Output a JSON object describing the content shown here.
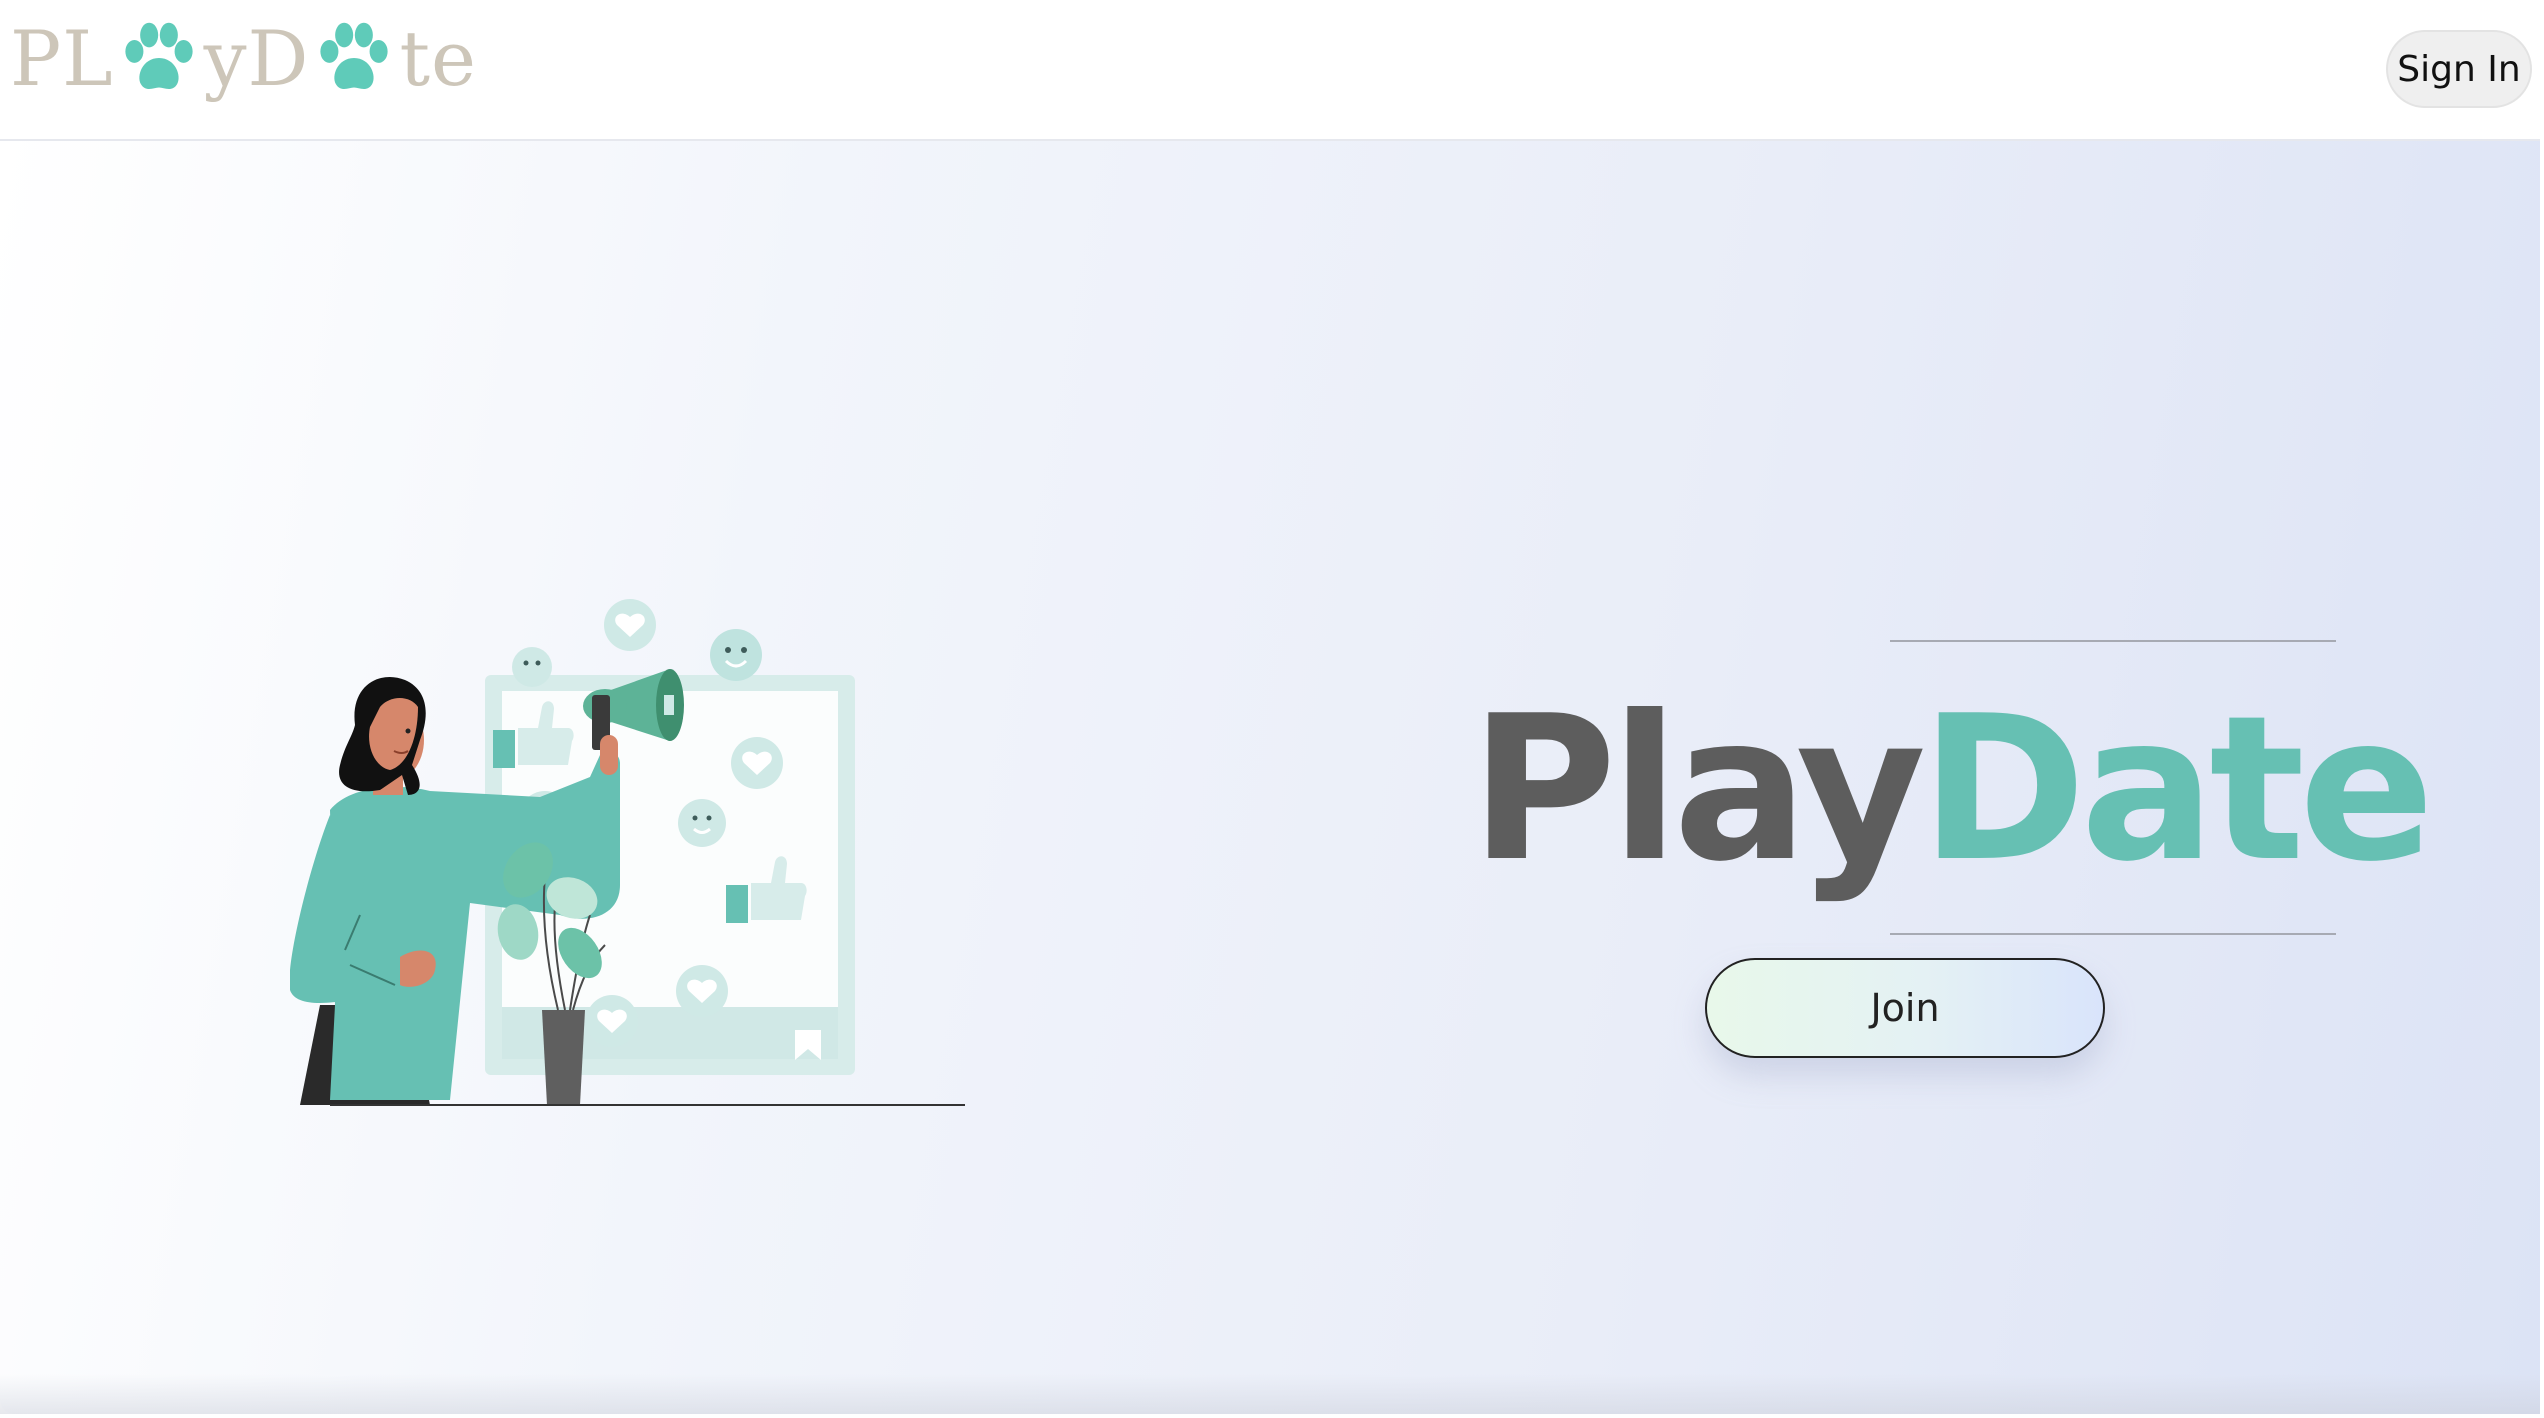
{
  "header": {
    "logo": {
      "segments": [
        "PL",
        "y",
        "D",
        "te"
      ],
      "paw_icon": "paw-icon",
      "colors": {
        "text": "#cdc6b9",
        "paw": "#5fcbb9"
      }
    },
    "sign_in_label": "Sign In"
  },
  "hero": {
    "illustration": "woman-with-megaphone-social-media",
    "brand_play": "Play",
    "brand_date": "Date",
    "join_label": "Join",
    "colors": {
      "play": "#5d5d5d",
      "date": "#66c0b3",
      "accent": "#66c0b3",
      "background_start": "#ffffff",
      "background_end": "#dce3f5"
    }
  }
}
